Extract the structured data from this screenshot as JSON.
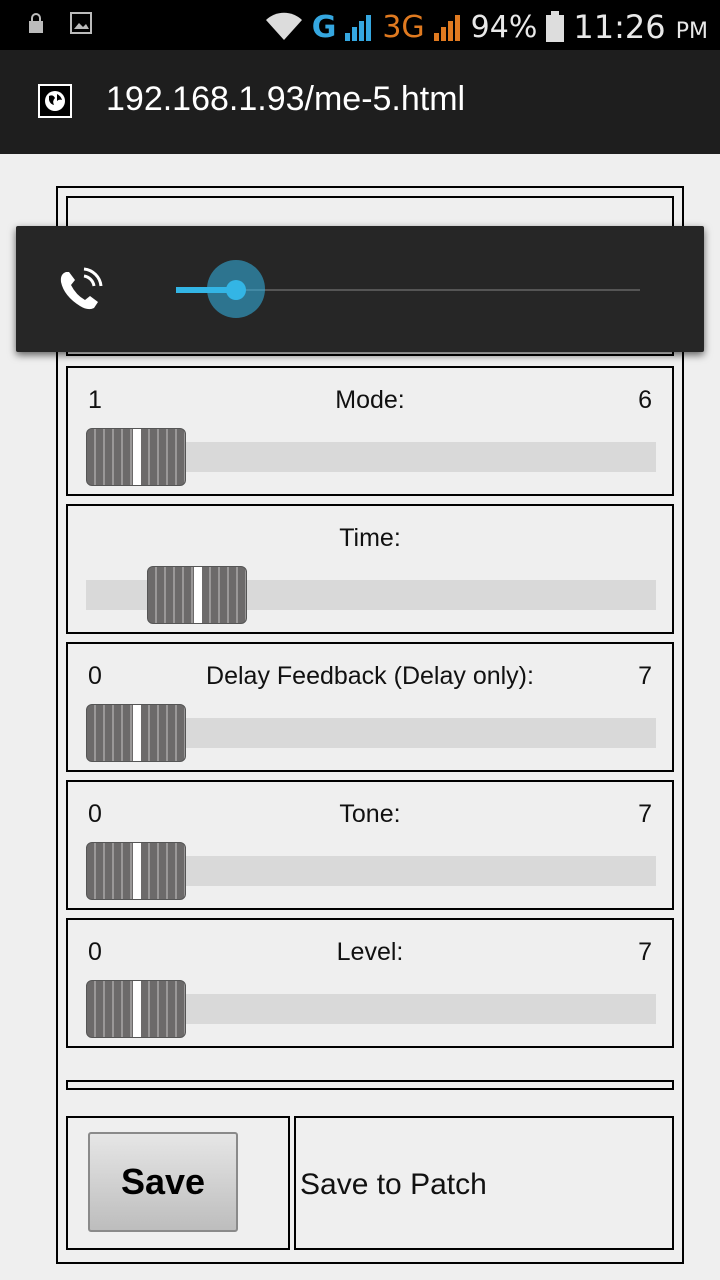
{
  "status_bar": {
    "signal_g": "G",
    "signal_3g": "3G",
    "battery": "94%",
    "time": "11:26",
    "ampm": "PM",
    "icons": [
      "lock-icon",
      "image-icon",
      "wifi-icon",
      "signal-icon",
      "battery-icon"
    ]
  },
  "browser": {
    "url": "192.168.1.93/me-5.html",
    "icon": "globe-icon"
  },
  "volume_overlay": {
    "icon": "phone-volume-icon",
    "level": 0.13,
    "accent": "#33b5e5"
  },
  "sliders": [
    {
      "min": "1",
      "label": "Mode:",
      "max": "6",
      "value_fraction": 0.0
    },
    {
      "min": "",
      "label": "Time:",
      "max": "",
      "value_fraction": 0.13
    },
    {
      "min": "0",
      "label": "Delay Feedback (Delay only):",
      "max": "7",
      "value_fraction": 0.0
    },
    {
      "min": "0",
      "label": "Tone:",
      "max": "7",
      "value_fraction": 0.0
    },
    {
      "min": "0",
      "label": "Level:",
      "max": "7",
      "value_fraction": 0.0
    }
  ],
  "actions": {
    "save_label": "Save",
    "patch_label": "Save to Patch"
  }
}
